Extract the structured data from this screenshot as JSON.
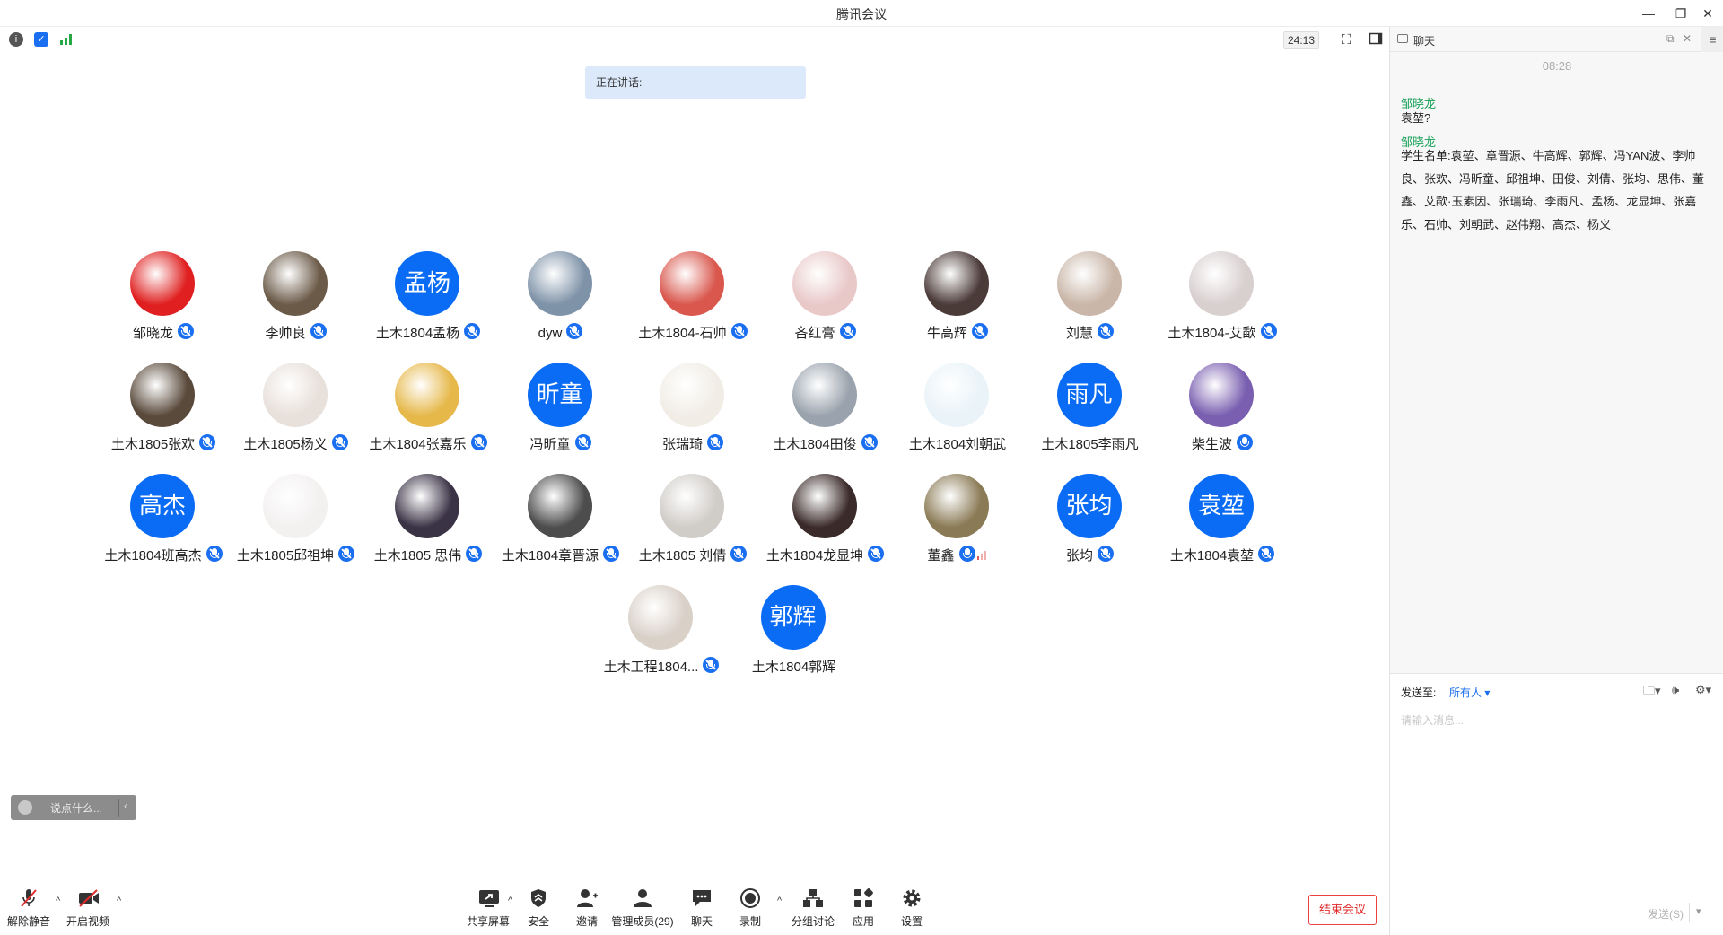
{
  "window": {
    "title": "腾讯会议",
    "min": "—",
    "restore": "❐",
    "close": "✕"
  },
  "meeting": {
    "timer": "24:13",
    "speaking_label": "正在讲话:"
  },
  "participants": [
    {
      "name": "邹晓龙",
      "avatar_text": "",
      "avatar_color": "#e02020",
      "mic": "muted"
    },
    {
      "name": "李帅良",
      "avatar_text": "",
      "avatar_color": "#6b5a48",
      "mic": "muted"
    },
    {
      "name": "土木1804孟杨",
      "avatar_text": "孟杨",
      "avatar_color": "#0a6cf5",
      "mic": "muted"
    },
    {
      "name": "dyw",
      "avatar_text": "",
      "avatar_color": "#7f93a8",
      "mic": "muted"
    },
    {
      "name": "土木1804-石帅",
      "avatar_text": "",
      "avatar_color": "#d9574d",
      "mic": "muted"
    },
    {
      "name": "吝红膏",
      "avatar_text": "",
      "avatar_color": "#e9c8c8",
      "mic": "muted"
    },
    {
      "name": "牛高辉",
      "avatar_text": "",
      "avatar_color": "#4a3a38",
      "mic": "muted"
    },
    {
      "name": "刘慧",
      "avatar_text": "",
      "avatar_color": "#c9b6a8",
      "mic": "muted"
    },
    {
      "name": "土木1804-艾歃",
      "avatar_text": "",
      "avatar_color": "#d8cfcf",
      "mic": "muted"
    },
    {
      "name": "土木1805张欢",
      "avatar_text": "",
      "avatar_color": "#5a4a3c",
      "mic": "muted"
    },
    {
      "name": "土木1805杨义",
      "avatar_text": "",
      "avatar_color": "#e8e0da",
      "mic": "muted"
    },
    {
      "name": "土木1804张嘉乐",
      "avatar_text": "",
      "avatar_color": "#e6b84a",
      "mic": "muted"
    },
    {
      "name": "冯昕童",
      "avatar_text": "昕童",
      "avatar_color": "#0a6cf5",
      "mic": "muted"
    },
    {
      "name": "张瑞琦",
      "avatar_text": "",
      "avatar_color": "#f1ede6",
      "mic": "muted"
    },
    {
      "name": "土木1804田俊",
      "avatar_text": "",
      "avatar_color": "#9aa3ad",
      "mic": "muted"
    },
    {
      "name": "土木1804刘朝武",
      "avatar_text": "",
      "avatar_color": "#e9f3f8",
      "mic": "none"
    },
    {
      "name": "土木1805李雨凡",
      "avatar_text": "雨凡",
      "avatar_color": "#0a6cf5",
      "mic": "none"
    },
    {
      "name": "柴生波",
      "avatar_text": "",
      "avatar_color": "#7a5fb0",
      "mic": "on"
    },
    {
      "name": "土木1804班高杰",
      "avatar_text": "高杰",
      "avatar_color": "#0a6cf5",
      "mic": "muted"
    },
    {
      "name": "土木1805邱祖坤",
      "avatar_text": "",
      "avatar_color": "#f3f0f0",
      "mic": "muted"
    },
    {
      "name": "土木1805 思伟",
      "avatar_text": "",
      "avatar_color": "#3a3245",
      "mic": "muted"
    },
    {
      "name": "土木1804章晋源",
      "avatar_text": "",
      "avatar_color": "#4d4d4d",
      "mic": "muted"
    },
    {
      "name": "土木1805 刘倩",
      "avatar_text": "",
      "avatar_color": "#d0ccc8",
      "mic": "muted"
    },
    {
      "name": "土木1804龙显坤",
      "avatar_text": "",
      "avatar_color": "#3b2a2a",
      "mic": "muted"
    },
    {
      "name": "董鑫",
      "avatar_text": "",
      "avatar_color": "#8a7a55",
      "mic": "speaking"
    },
    {
      "name": "张均",
      "avatar_text": "张均",
      "avatar_color": "#0a6cf5",
      "mic": "muted"
    },
    {
      "name": "土木1804袁堃",
      "avatar_text": "袁堃",
      "avatar_color": "#0a6cf5",
      "mic": "muted"
    },
    {
      "name": "土木工程1804...",
      "avatar_text": "",
      "avatar_color": "#d9d0c8",
      "mic": "muted"
    },
    {
      "name": "土木1804郭辉",
      "avatar_text": "郭辉",
      "avatar_color": "#0a6cf5",
      "mic": "none"
    }
  ],
  "saybox": {
    "placeholder": "说点什么...",
    "arrow": "‹"
  },
  "toolbar": {
    "unmute": "解除静音",
    "video": "开启视频",
    "share": "共享屏幕",
    "security": "安全",
    "invite": "邀请",
    "members": "管理成员(29)",
    "chat": "聊天",
    "record": "录制",
    "breakout": "分组讨论",
    "apps": "应用",
    "settings": "设置",
    "end": "结束会议"
  },
  "chat": {
    "title": "聊天",
    "time": "08:28",
    "messages": [
      {
        "sender": "邹晓龙",
        "text": "袁堃?"
      },
      {
        "sender": "邹晓龙",
        "text": "学生名单:袁堃、章晋源、牛高辉、郭辉、冯YAN波、李帅良、张欢、冯昕童、邱祖坤、田俊、刘倩、张均、思伟、董鑫、艾歃·玉素因、张瑞琦、李雨凡、孟杨、龙显坤、张嘉乐、石帅、刘朝武、赵伟翔、高杰、杨义"
      }
    ],
    "send_to_label": "发送至:",
    "send_to_value": "所有人 ▾",
    "input_placeholder": "请输入消息...",
    "send_button": "发送(S)"
  },
  "colors": {
    "accent": "#0a6cf5",
    "end_red": "#e02b2b",
    "sender_green": "#18a058"
  }
}
